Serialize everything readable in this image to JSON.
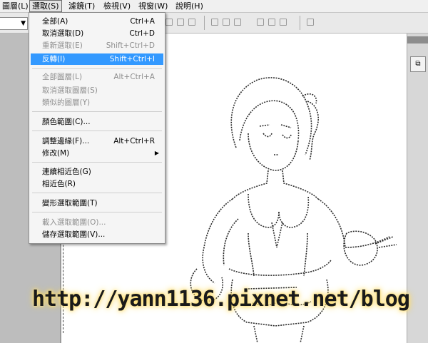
{
  "menubar": {
    "items": [
      {
        "label": "圖層(L)"
      },
      {
        "label": "選取(S)"
      },
      {
        "label": "濾鏡(T)"
      },
      {
        "label": "檢視(V)"
      },
      {
        "label": "視窗(W)"
      },
      {
        "label": "說明(H)"
      }
    ]
  },
  "select_menu": {
    "items": [
      {
        "label": "全部(A)",
        "shortcut": "Ctrl+A",
        "enabled": true
      },
      {
        "label": "取消選取(D)",
        "shortcut": "Ctrl+D",
        "enabled": true
      },
      {
        "label": "重新選取(E)",
        "shortcut": "Shift+Ctrl+D",
        "enabled": false
      },
      {
        "label": "反轉(I)",
        "shortcut": "Shift+Ctrl+I",
        "enabled": true,
        "highlighted": true
      },
      {
        "label": "全部圖層(L)",
        "shortcut": "Alt+Ctrl+A",
        "enabled": false
      },
      {
        "label": "取消選取圖層(S)",
        "shortcut": "",
        "enabled": false
      },
      {
        "label": "類似的圖層(Y)",
        "shortcut": "",
        "enabled": false
      },
      {
        "label": "顏色範圍(C)...",
        "shortcut": "",
        "enabled": true
      },
      {
        "label": "調整邊緣(F)...",
        "shortcut": "Alt+Ctrl+R",
        "enabled": true
      },
      {
        "label": "修改(M)",
        "shortcut": "",
        "enabled": true,
        "submenu": true
      },
      {
        "label": "連續相近色(G)",
        "shortcut": "",
        "enabled": true
      },
      {
        "label": "相近色(R)",
        "shortcut": "",
        "enabled": true
      },
      {
        "label": "變形選取範圍(T)",
        "shortcut": "",
        "enabled": true
      },
      {
        "label": "載入選取範圍(O)...",
        "shortcut": "",
        "enabled": false
      },
      {
        "label": "儲存選取範圍(V)...",
        "shortcut": "",
        "enabled": true
      }
    ]
  },
  "watermark": {
    "text": "http://yann1136.pixnet.net/blog"
  },
  "colors": {
    "highlight": "#3399ff",
    "disabled": "#8f8f8f"
  }
}
